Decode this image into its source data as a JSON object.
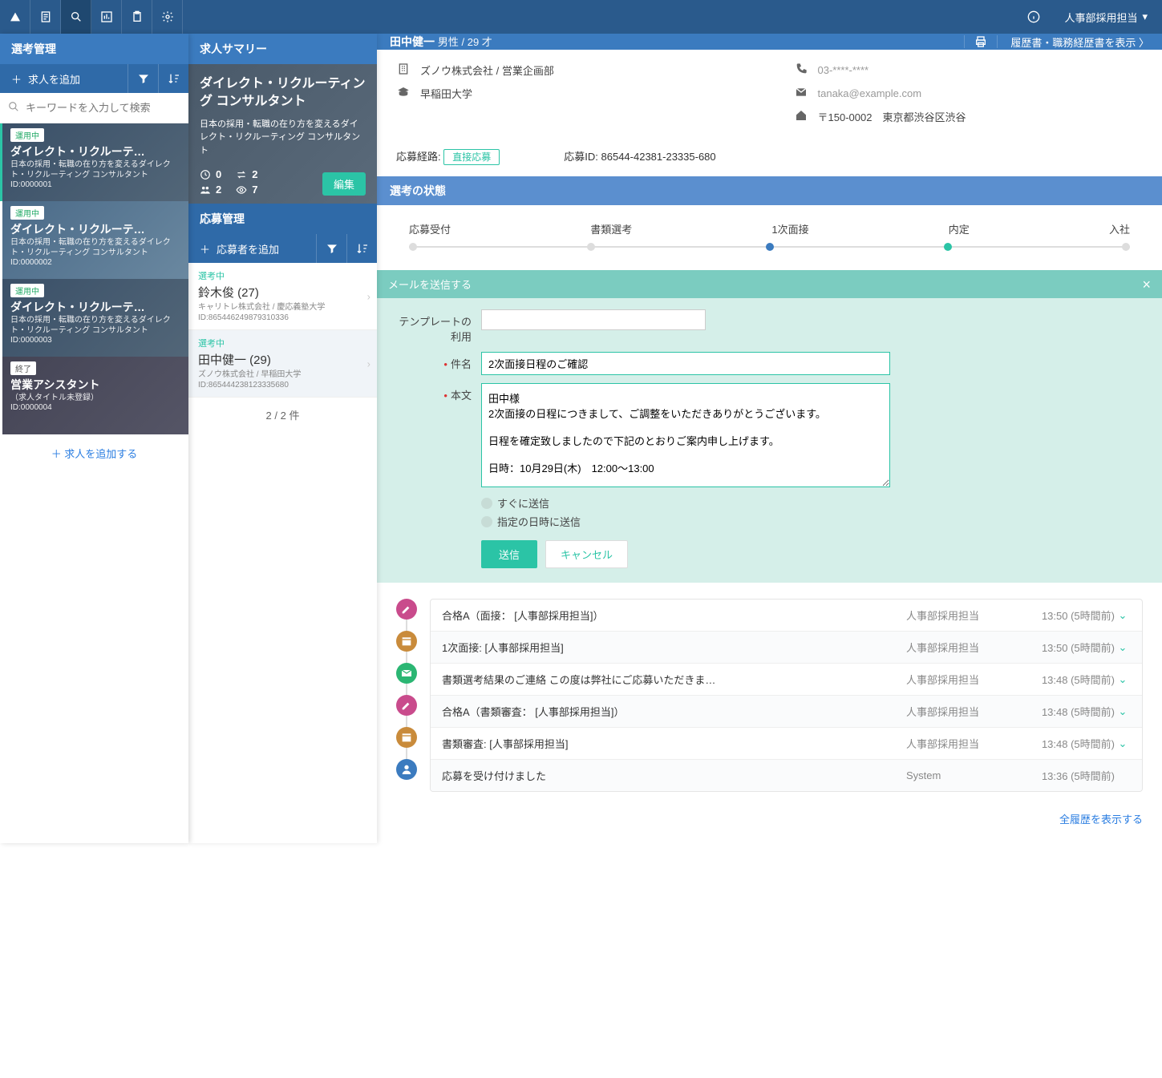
{
  "topnav": {
    "user": "人事部採用担当"
  },
  "col1": {
    "title": "選考管理",
    "add_button": "求人を追加",
    "search_placeholder": "キーワードを入力して検索",
    "add_link": "＋  求人を追加する",
    "jobs": [
      {
        "tag": "運用中",
        "title": "ダイレクト・リクルーテ…",
        "desc": "日本の採用・転職の在り方を変えるダイレクト・リクルーティング コンサルタント",
        "id": "ID:0000001"
      },
      {
        "tag": "運用中",
        "title": "ダイレクト・リクルーテ…",
        "desc": "日本の採用・転職の在り方を変えるダイレクト・リクルーティング コンサルタント",
        "id": "ID:0000002"
      },
      {
        "tag": "運用中",
        "title": "ダイレクト・リクルーテ…",
        "desc": "日本の採用・転職の在り方を変えるダイレクト・リクルーティング コンサルタント",
        "id": "ID:0000003"
      },
      {
        "tag": "終了",
        "title": "営業アシスタント",
        "desc": "（求人タイトル未登録）",
        "id": "ID:0000004"
      }
    ]
  },
  "col2": {
    "head": "求人サマリー",
    "summary_title": "ダイレクト・リクルーティング コンサルタント",
    "summary_desc": "日本の採用・転職の在り方を変えるダイレクト・リクルーティング コンサルタント",
    "stats": {
      "a": "0",
      "b": "2",
      "c": "2",
      "d": "7"
    },
    "edit": "編集",
    "sect": "応募管理",
    "add_applicant": "応募者を追加",
    "applicants": [
      {
        "status": "選考中",
        "name": "鈴木俊  (27)",
        "meta1": "キャリトレ株式会社 / 慶応義塾大学",
        "meta2": "ID:865446249879310336"
      },
      {
        "status": "選考中",
        "name": "田中健一  (29)",
        "meta1": "ズノウ株式会社 / 早稲田大学",
        "meta2": "ID:865444238123335680"
      }
    ],
    "footer": "2 / 2 件"
  },
  "col3": {
    "name": "田中健一",
    "sub": "男性 / 29 才",
    "resume_link": "履歴書・職務経歴書を表示  〉",
    "profile": {
      "company": "ズノウ株式会社 / 営業企画部",
      "school": "早稲田大学",
      "phone": "03-****-****",
      "email": "tanaka@example.com",
      "address": "〒150-0002　東京都渋谷区渋谷"
    },
    "apply_route_label": "応募経路:",
    "apply_route": "直接応募",
    "apply_id_label": "応募ID:",
    "apply_id": "86544-42381-23335-680",
    "stage_head": "選考の状態",
    "stages": [
      "応募受付",
      "書類選考",
      "1次面接",
      "内定",
      "入社"
    ],
    "mail": {
      "head": "メールを送信する",
      "tmpl_label": "テンプレートの利用",
      "subject_label": "件名",
      "subject": "2次面接日程のご確認",
      "body_label": "本文",
      "body": "田中様\n2次面接の日程につきまして、ご調整をいただきありがとうございます。\n\n日程を確定致しましたので下記のとおりご案内申し上げます。\n\n日時：10月29日(木)　12:00〜13:00",
      "opt_now": "すぐに送信",
      "opt_sched": "指定の日時に送信",
      "send": "送信",
      "cancel": "キャンセル"
    },
    "timeline": [
      {
        "color": "b-pink",
        "title": "合格A（面接：  [人事部採用担当]）",
        "user": "人事部採用担当",
        "time": "13:50  (5時間前)",
        "chev": true
      },
      {
        "color": "b-orange",
        "title": "1次面接: [人事部採用担当]",
        "user": "人事部採用担当",
        "time": "13:50  (5時間前)",
        "chev": true
      },
      {
        "color": "b-green",
        "title": "書類選考結果のご連絡  この度は弊社にご応募いただきま…",
        "user": "人事部採用担当",
        "time": "13:48  (5時間前)",
        "chev": true
      },
      {
        "color": "b-pink",
        "title": "合格A（書類審査：  [人事部採用担当]）",
        "user": "人事部採用担当",
        "time": "13:48  (5時間前)",
        "chev": true
      },
      {
        "color": "b-orange",
        "title": "書類審査: [人事部採用担当]",
        "user": "人事部採用担当",
        "time": "13:48  (5時間前)",
        "chev": true
      },
      {
        "color": "b-blue",
        "title": "応募を受け付けました",
        "user": "System",
        "time": "13:36  (5時間前)",
        "chev": false
      }
    ],
    "show_all": "全履歴を表示する"
  }
}
